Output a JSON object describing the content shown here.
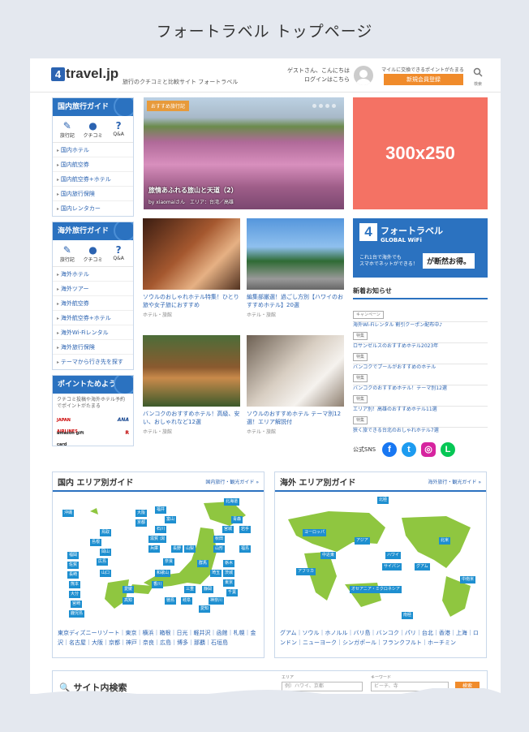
{
  "page_title": "フォートラベル トップページ",
  "header": {
    "logo_num": "4",
    "logo_text": "travel.jp",
    "tagline": "旅行のクチコミと比較サイト フォートラベル",
    "guest_line1": "ゲストさん、こんにちは",
    "guest_line2": "ログインはこちら",
    "promo": "マイルに交換できるポイントがたまる",
    "register": "新規会員登録",
    "search_label": "検索"
  },
  "sidebar": {
    "domestic": {
      "title": "国内旅行ガイド",
      "icons": [
        {
          "icon": "✎",
          "label": "旅行記"
        },
        {
          "icon": "●",
          "label": "クチコミ"
        },
        {
          "icon": "?",
          "label": "Q&A"
        }
      ],
      "items": [
        "国内ホテル",
        "国内航空券",
        "国内航空券+ホテル",
        "国内旅行保険",
        "国内レンタカー"
      ]
    },
    "overseas": {
      "title": "海外旅行ガイド",
      "icons": [
        {
          "icon": "✎",
          "label": "旅行記"
        },
        {
          "icon": "●",
          "label": "クチコミ"
        },
        {
          "icon": "?",
          "label": "Q&A"
        }
      ],
      "items": [
        "海外ホテル",
        "海外ツアー",
        "海外航空券",
        "海外航空券+ホテル",
        "海外Wi-Fiレンタル",
        "海外旅行保険",
        "テーマから行き先を探す"
      ]
    },
    "points": {
      "title": "ポイントためよう",
      "text": "クチコミ投稿や海外ホテル予約でポイントがたまる",
      "logos": [
        "JAPAN AIRLINES",
        "ANA",
        "amazon gift card",
        "R"
      ]
    }
  },
  "hero": {
    "tag": "おすすめ旅行記",
    "title": "旅情あふれる旅山と天道（2）",
    "byline": "by xiaomaiさん　エリア：台湾／高雄"
  },
  "ad": {
    "label": "300x250"
  },
  "cards": [
    {
      "title": "ソウルのおしゃれホテル特集！ひとり旅や女子旅におすすめ",
      "category": "ホテル・旅館"
    },
    {
      "title": "編集部厳選！過ごし方別【ハワイのおすすめホテル】20選",
      "category": "ホテル・旅館"
    },
    {
      "title": "バンコクのおすすめホテル！高級、安い、おしゃれなど12選",
      "category": "ホテル・旅館"
    },
    {
      "title": "ソウルのおすすめホテル テーマ別12選！エリア解説付",
      "category": "ホテル・旅館"
    }
  ],
  "wifi_banner": {
    "num": "4",
    "brand": "フォートラベル",
    "sub": "GLOBAL WiFi",
    "line1": "これ1台で海外でも",
    "line2": "スマホでネットができる！",
    "right": "が断然お得。"
  },
  "news": {
    "title": "新着お知らせ",
    "items": [
      {
        "badge": "キャンペーン",
        "text": "海外Wi-Fiレンタル 割引クーポン配布中♪"
      },
      {
        "badge": "特集",
        "text": "ロサンゼルスのおすすめホテル2023年"
      },
      {
        "badge": "特集",
        "text": "バンコクでプールがおすすめのホテル"
      },
      {
        "badge": "特集",
        "text": "バンコクのおすすめホテル！テーマ別12選"
      },
      {
        "badge": "特集",
        "text": "エリア別！高雄のおすすめホテル11選"
      },
      {
        "badge": "特集",
        "text": "狭く旅できる台北のおしゃれホテル7選"
      }
    ]
  },
  "sns": {
    "label": "公式SNS",
    "icons": [
      {
        "name": "facebook",
        "glyph": "f",
        "color": "#1877f2"
      },
      {
        "name": "twitter",
        "glyph": "t",
        "color": "#1d9bf0"
      },
      {
        "name": "instagram",
        "glyph": "◎",
        "color": "#d6249f"
      },
      {
        "name": "line",
        "glyph": "L",
        "color": "#06c755"
      }
    ]
  },
  "domestic_guide": {
    "title": "国内 エリア別ガイド",
    "link": "国内旅行・観光ガイド »",
    "labels": [
      "北海道",
      "沖縄",
      "宮城",
      "岩手",
      "秋田",
      "青森",
      "山形",
      "福島",
      "新潟",
      "石川",
      "富山",
      "福井",
      "長野",
      "山梨",
      "群馬",
      "栃木",
      "茨城",
      "埼玉",
      "東京",
      "千葉",
      "神奈川",
      "静岡",
      "愛知",
      "岐阜",
      "三重",
      "京都",
      "大阪",
      "兵庫",
      "奈良",
      "和歌山",
      "滋賀",
      "鳥取",
      "島根",
      "岡山",
      "広島",
      "山口",
      "香川",
      "徳島",
      "愛媛",
      "高知",
      "福岡",
      "佐賀",
      "長崎",
      "熊本",
      "大分",
      "宮崎",
      "鹿児島"
    ],
    "links": "東京ディズニーリゾート｜東京｜横浜｜箱根｜日光｜軽井沢｜函館｜札幌｜金沢｜名古屋｜大阪｜京都｜神戸｜奈良｜広島｜博多｜那覇｜石垣島"
  },
  "overseas_guide": {
    "title": "海外 エリア別ガイド",
    "link": "海外旅行・観光ガイド »",
    "labels": [
      "北極",
      "ヨーロッパ",
      "アジア",
      "中近東",
      "北米",
      "アフリカ",
      "ハワイ",
      "サイパン",
      "グアム",
      "中南米",
      "オセアニア・ミクロネシア",
      "南極"
    ],
    "links": "グアム｜ソウル｜ホノルル｜バリ島｜バンコク｜パリ｜台北｜香港｜上海｜ロンドン｜ニューヨーク｜シンガポール｜フランクフルト｜ホーチミン"
  },
  "site_search": {
    "title": "サイト内検索",
    "area_label": "エリア",
    "keyword_label": "キーワード",
    "area_placeholder": "例）ハワイ、京都",
    "keyword_placeholder": "ビーチ、寺",
    "button": "検索"
  }
}
